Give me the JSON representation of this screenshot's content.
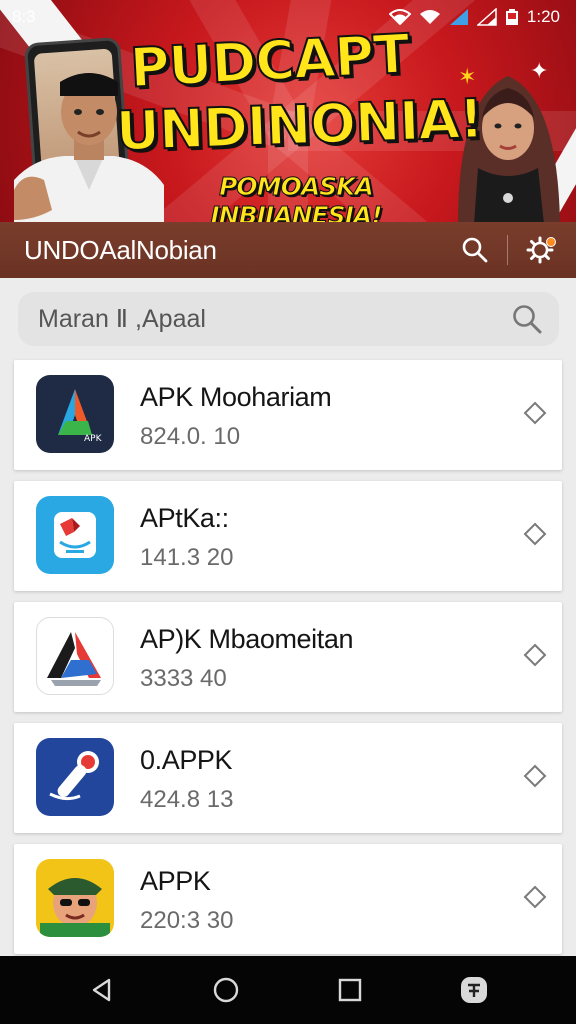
{
  "status_bar": {
    "carrier": "8:3",
    "time": "1:20"
  },
  "banner": {
    "headline_line1": "PUDCAPT",
    "headline_line2": "UNDINONIA!",
    "subheadline": "POMOASKA INBIIANESIA!"
  },
  "app_bar": {
    "title": "UNDOAalNobian",
    "icons": [
      "search-icon",
      "settings-icon"
    ]
  },
  "search": {
    "placeholder": "Maran Ⅱ ,Apaal"
  },
  "apps": [
    {
      "name": "APK Moohariam",
      "version": "824.0. 10",
      "icon": "triangle-logo-dark"
    },
    {
      "name": "APtKa::",
      "version": "141.3 20",
      "icon": "blue-document-logo"
    },
    {
      "name": "AP)K Mbaomeitan",
      "version": "3333 40",
      "icon": "tricolor-triangle-logo"
    },
    {
      "name": "0.APPK",
      "version": "424.8 13",
      "icon": "microphone-logo"
    },
    {
      "name": "APPK",
      "version": "220:3 30",
      "icon": "cartoon-face-logo"
    }
  ],
  "nav_bar": {
    "buttons": [
      "back-icon",
      "home-icon",
      "recents-icon",
      "assistant-icon"
    ]
  },
  "colors": {
    "banner_red": "#c7181d",
    "headline_yellow": "#ffe51a",
    "app_bar_brown": "#6f3526",
    "list_background": "#ececec",
    "nav_black": "#050505"
  }
}
